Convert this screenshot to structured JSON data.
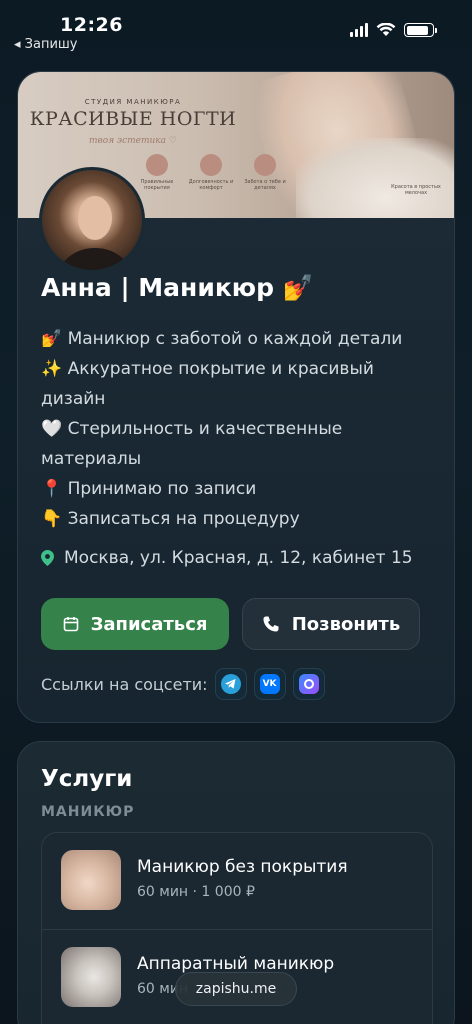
{
  "status_bar": {
    "time": "12:26",
    "back_label": "◂ Запишу",
    "battery_level": 0.85
  },
  "banner": {
    "subtitle": "СТУДИЯ МАНИКЮРА",
    "title": "КРАСИВЫЕ НОГТИ",
    "tagline": "твоя эстетика ♡",
    "features": [
      "Правильные покрытия",
      "Долговечность и комфорт",
      "Забота о тебе и деталях"
    ],
    "note": "Красота в простых мелочах"
  },
  "profile": {
    "name": "Анна | Маникюр 💅",
    "description": [
      "💅 Маникюр с заботой о каждой детали",
      "✨ Аккуратное покрытие и красивый дизайн",
      "🤍 Стерильность и качественные материалы",
      "📍 Принимаю по записи",
      "👇 Записаться на процедуру"
    ],
    "address": "Москва, ул. Красная, д. 12, кабинет 15"
  },
  "actions": {
    "book_label": "Записаться",
    "call_label": "Позвонить"
  },
  "socials": {
    "label": "Ссылки на соцсети:",
    "items": [
      {
        "name": "telegram-icon",
        "color": "#2aa0da",
        "glyph": "➤"
      },
      {
        "name": "vk-icon",
        "color": "#0077ff",
        "glyph": "VK"
      },
      {
        "name": "max-icon",
        "color": "#7b5cff",
        "glyph": "◯"
      }
    ]
  },
  "services": {
    "title": "Услуги",
    "category": "МАНИКЮР",
    "items": [
      {
        "name": "Маникюр без покрытия",
        "meta": "60 мин · 1 000 ₽"
      },
      {
        "name": "Аппаратный маникюр",
        "meta": "60 мин"
      }
    ]
  },
  "url_pill": "zapishu.me",
  "colors": {
    "primary_green": "#35824b",
    "card_bg": "#1c2b35",
    "page_bg": "#0f1f29"
  }
}
